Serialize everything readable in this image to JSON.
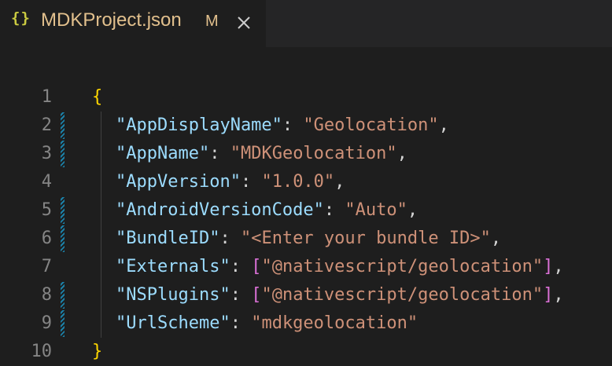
{
  "tab": {
    "icon": "{}",
    "title": "MDKProject.json",
    "status": "M",
    "close_icon": "close-icon"
  },
  "colors": {
    "background": "#1e1e1e",
    "tab_modified": "#e2c08d",
    "json_icon": "#cbcb41",
    "key": "#9cdcfe",
    "string": "#ce9178",
    "brace": "#ffd700",
    "bracket": "#da70d6",
    "line_number": "#858585",
    "gutter_modified": "#1b81a8"
  },
  "editor": {
    "lines": [
      {
        "number": "1",
        "modified": false
      },
      {
        "number": "2",
        "modified": true,
        "key": "\"AppDisplayName\"",
        "value": "\"Geolocation\""
      },
      {
        "number": "3",
        "modified": true,
        "key": "\"AppName\"",
        "value": "\"MDKGeolocation\""
      },
      {
        "number": "4",
        "modified": false,
        "key": "\"AppVersion\"",
        "value": "\"1.0.0\""
      },
      {
        "number": "5",
        "modified": true,
        "key": "\"AndroidVersionCode\"",
        "value": "\"Auto\""
      },
      {
        "number": "6",
        "modified": true,
        "key": "\"BundleID\"",
        "value": "\"<Enter your bundle ID>\""
      },
      {
        "number": "7",
        "modified": false,
        "key": "\"Externals\"",
        "value": "\"@nativescript/geolocation\""
      },
      {
        "number": "8",
        "modified": true,
        "key": "\"NSPlugins\"",
        "value": "\"@nativescript/geolocation\""
      },
      {
        "number": "9",
        "modified": true,
        "key": "\"UrlScheme\"",
        "value": "\"mdkgeolocation\""
      },
      {
        "number": "10",
        "modified": false
      }
    ],
    "open_brace": "{",
    "close_brace": "}",
    "colon": ": ",
    "comma": ",",
    "open_bracket": "[",
    "close_bracket": "]"
  }
}
